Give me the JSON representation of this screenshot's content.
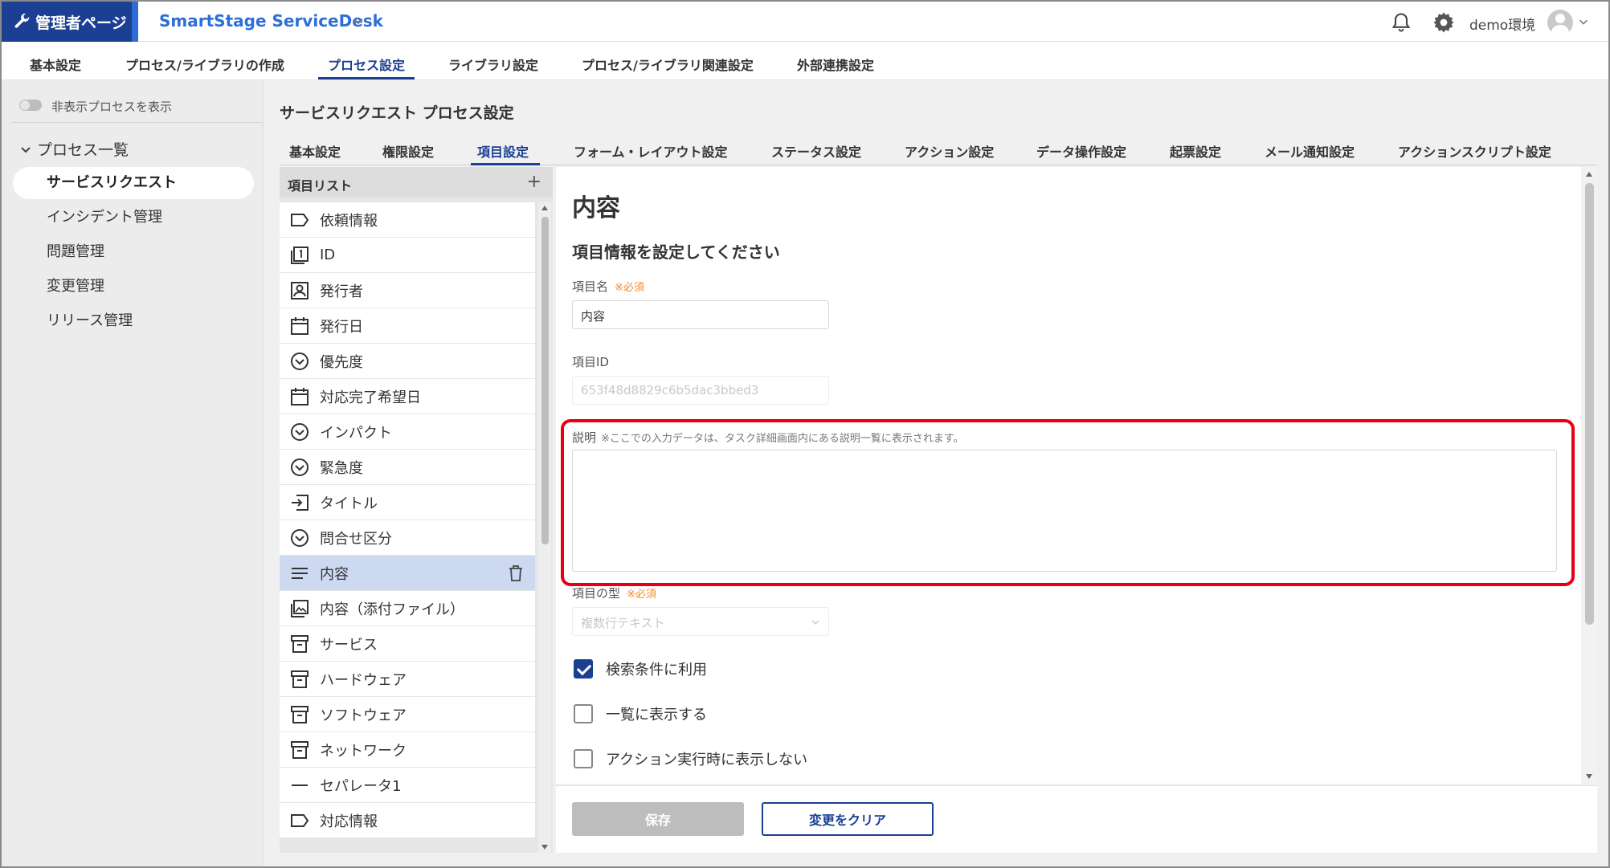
{
  "topbar": {
    "admin_label": "管理者ページ",
    "app_name": "SmartStage ServiceDesk",
    "env_name": "demo環境"
  },
  "mainnav": {
    "items": [
      {
        "label": "基本設定"
      },
      {
        "label": "プロセス/ライブラリの作成"
      },
      {
        "label": "プロセス設定",
        "active": true
      },
      {
        "label": "ライブラリ設定"
      },
      {
        "label": "プロセス/ライブラリ関連設定"
      },
      {
        "label": "外部連携設定"
      }
    ]
  },
  "sidebar": {
    "toggle_label": "非表示プロセスを表示",
    "toggle_on": false,
    "section_title": "プロセス一覧",
    "items": [
      {
        "label": "サービスリクエスト",
        "active": true
      },
      {
        "label": "インシデント管理"
      },
      {
        "label": "問題管理"
      },
      {
        "label": "変更管理"
      },
      {
        "label": "リリース管理"
      }
    ]
  },
  "content": {
    "title": "サービスリクエスト プロセス設定",
    "tabs": [
      {
        "label": "基本設定"
      },
      {
        "label": "権限設定"
      },
      {
        "label": "項目設定",
        "active": true
      },
      {
        "label": "フォーム・レイアウト設定"
      },
      {
        "label": "ステータス設定"
      },
      {
        "label": "アクション設定"
      },
      {
        "label": "データ操作設定"
      },
      {
        "label": "起票設定"
      },
      {
        "label": "メール通知設定"
      },
      {
        "label": "アクションスクリプト設定"
      }
    ]
  },
  "item_list": {
    "header": "項目リスト",
    "items": [
      {
        "label": "依頼情報",
        "icon": "label-icon"
      },
      {
        "label": "ID",
        "icon": "id-icon"
      },
      {
        "label": "発行者",
        "icon": "user-icon"
      },
      {
        "label": "発行日",
        "icon": "calendar-icon"
      },
      {
        "label": "優先度",
        "icon": "dropdown-icon"
      },
      {
        "label": "対応完了希望日",
        "icon": "calendar-icon"
      },
      {
        "label": "インパクト",
        "icon": "dropdown-icon"
      },
      {
        "label": "緊急度",
        "icon": "dropdown-icon"
      },
      {
        "label": "タイトル",
        "icon": "text-input-icon"
      },
      {
        "label": "問合せ区分",
        "icon": "dropdown-icon"
      },
      {
        "label": "内容",
        "icon": "multiline-icon",
        "selected": true
      },
      {
        "label": "内容（添付ファイル）",
        "icon": "image-icon"
      },
      {
        "label": "サービス",
        "icon": "archive-icon"
      },
      {
        "label": "ハードウェア",
        "icon": "archive-icon"
      },
      {
        "label": "ソフトウェア",
        "icon": "archive-icon"
      },
      {
        "label": "ネットワーク",
        "icon": "archive-icon"
      },
      {
        "label": "セパレータ1",
        "icon": "separator-icon"
      },
      {
        "label": "対応情報",
        "icon": "label-icon"
      }
    ]
  },
  "detail": {
    "title": "内容",
    "subtitle": "項目情報を設定してください",
    "name_label": "項目名",
    "required_mark": "※必須",
    "name_value": "内容",
    "id_label": "項目ID",
    "id_value": "653f48d8829c6b5dac3bbed3",
    "desc_label": "説明",
    "desc_note": "※ここでの入力データは、タスク詳細画面内にある説明一覧に表示されます。",
    "desc_value": "",
    "type_label": "項目の型",
    "type_value": "複数行テキスト",
    "checkboxes": [
      {
        "label": "検索条件に利用",
        "checked": true
      },
      {
        "label": "一覧に表示する",
        "checked": false
      },
      {
        "label": "アクション実行時に表示しない",
        "checked": false
      }
    ]
  },
  "footer": {
    "save_label": "保存",
    "clear_label": "変更をクリア"
  },
  "colors": {
    "brand": "#1b3f92",
    "accent": "#2d6fd7",
    "required": "#f08a2c",
    "highlight": "#e60012",
    "selected_row": "#ccd9f1"
  }
}
